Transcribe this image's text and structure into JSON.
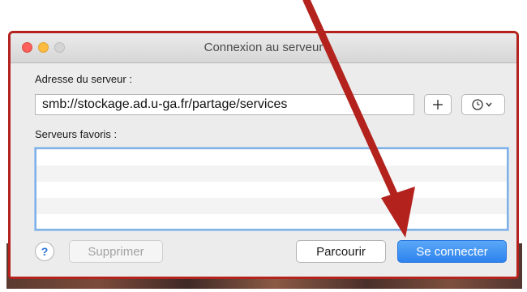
{
  "window": {
    "title": "Connexion au serveur"
  },
  "address": {
    "label": "Adresse du serveur :",
    "value": "smb://stockage.ad.u-ga.fr/partage/services"
  },
  "favorites": {
    "label": "Serveurs favoris :",
    "rows": [
      "",
      "",
      "",
      ""
    ]
  },
  "buttons": {
    "add": "+",
    "help": "?",
    "delete": "Supprimer",
    "browse": "Parcourir",
    "connect": "Se connecter"
  },
  "icons": {
    "add": "plus-icon",
    "recent": "clock-icon",
    "recent_menu": "chevron-down-icon",
    "help": "question-icon",
    "annotation": "arrow-icon"
  },
  "colors": {
    "accent": "#2d82ee",
    "annotation": "#b3221d",
    "close": "#fc605c",
    "minimize": "#fdbc40"
  }
}
